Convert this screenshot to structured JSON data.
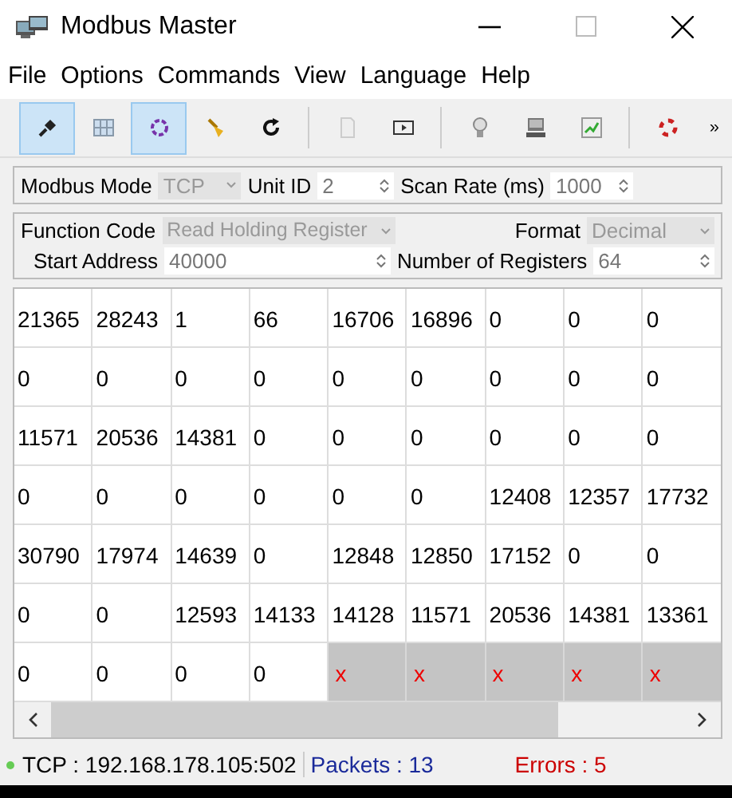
{
  "window": {
    "title": "Modbus Master"
  },
  "menu": [
    "File",
    "Options",
    "Commands",
    "View",
    "Language",
    "Help"
  ],
  "toolbar": [
    [
      {
        "kind": "plug",
        "selected": true
      },
      {
        "kind": "grid",
        "selected": false
      },
      {
        "kind": "ring",
        "selected": true
      },
      {
        "kind": "broom",
        "selected": false
      },
      {
        "kind": "refresh",
        "selected": false
      }
    ],
    [
      {
        "kind": "page",
        "selected": false
      },
      {
        "kind": "screen",
        "selected": false
      }
    ],
    [
      {
        "kind": "bulb",
        "selected": false
      },
      {
        "kind": "monitor",
        "selected": false
      },
      {
        "kind": "chart",
        "selected": false
      }
    ],
    [
      {
        "kind": "lifebuoy",
        "selected": false
      }
    ]
  ],
  "toolbar_overflow": "»",
  "connection": {
    "mode_label": "Modbus Mode",
    "mode": "TCP",
    "unit_label": "Unit ID",
    "unit": "2",
    "scan_label": "Scan Rate (ms)",
    "scan": "1000"
  },
  "request": {
    "function_label": "Function Code",
    "function": "Read Holding Register",
    "format_label": "Format",
    "format": "Decimal",
    "start_label": "Start Address",
    "start": "40000",
    "count_label": "Number of Registers",
    "count": "64"
  },
  "table": {
    "rows": [
      [
        {
          "text": "21365",
          "error": false
        },
        {
          "text": "28243",
          "error": false
        },
        {
          "text": "1",
          "error": false
        },
        {
          "text": "66",
          "error": false
        },
        {
          "text": "16706",
          "error": false
        },
        {
          "text": "16896",
          "error": false
        },
        {
          "text": "0",
          "error": false
        },
        {
          "text": "0",
          "error": false
        },
        {
          "text": "0",
          "error": false
        }
      ],
      [
        {
          "text": "0",
          "error": false
        },
        {
          "text": "0",
          "error": false
        },
        {
          "text": "0",
          "error": false
        },
        {
          "text": "0",
          "error": false
        },
        {
          "text": "0",
          "error": false
        },
        {
          "text": "0",
          "error": false
        },
        {
          "text": "0",
          "error": false
        },
        {
          "text": "0",
          "error": false
        },
        {
          "text": "0",
          "error": false
        }
      ],
      [
        {
          "text": "11571",
          "error": false
        },
        {
          "text": "20536",
          "error": false
        },
        {
          "text": "14381",
          "error": false
        },
        {
          "text": "0",
          "error": false
        },
        {
          "text": "0",
          "error": false
        },
        {
          "text": "0",
          "error": false
        },
        {
          "text": "0",
          "error": false
        },
        {
          "text": "0",
          "error": false
        },
        {
          "text": "0",
          "error": false
        }
      ],
      [
        {
          "text": "0",
          "error": false
        },
        {
          "text": "0",
          "error": false
        },
        {
          "text": "0",
          "error": false
        },
        {
          "text": "0",
          "error": false
        },
        {
          "text": "0",
          "error": false
        },
        {
          "text": "0",
          "error": false
        },
        {
          "text": "12408",
          "error": false
        },
        {
          "text": "12357",
          "error": false
        },
        {
          "text": "17732",
          "error": false
        }
      ],
      [
        {
          "text": "30790",
          "error": false
        },
        {
          "text": "17974",
          "error": false
        },
        {
          "text": "14639",
          "error": false
        },
        {
          "text": "0",
          "error": false
        },
        {
          "text": "12848",
          "error": false
        },
        {
          "text": "12850",
          "error": false
        },
        {
          "text": "17152",
          "error": false
        },
        {
          "text": "0",
          "error": false
        },
        {
          "text": "0",
          "error": false
        }
      ],
      [
        {
          "text": "0",
          "error": false
        },
        {
          "text": "0",
          "error": false
        },
        {
          "text": "12593",
          "error": false
        },
        {
          "text": "14133",
          "error": false
        },
        {
          "text": "14128",
          "error": false
        },
        {
          "text": "11571",
          "error": false
        },
        {
          "text": "20536",
          "error": false
        },
        {
          "text": "14381",
          "error": false
        },
        {
          "text": "13361",
          "error": false
        }
      ],
      [
        {
          "text": "0",
          "error": false
        },
        {
          "text": "0",
          "error": false
        },
        {
          "text": "0",
          "error": false
        },
        {
          "text": "0",
          "error": false
        },
        {
          "text": "x",
          "error": true
        },
        {
          "text": "x",
          "error": true
        },
        {
          "text": "x",
          "error": true
        },
        {
          "text": "x",
          "error": true
        },
        {
          "text": "x",
          "error": true
        }
      ]
    ]
  },
  "status_bar": {
    "connected": true,
    "connection": "TCP : 192.168.178.105:502",
    "packets": "Packets : 13",
    "errors": "Errors : 5"
  }
}
